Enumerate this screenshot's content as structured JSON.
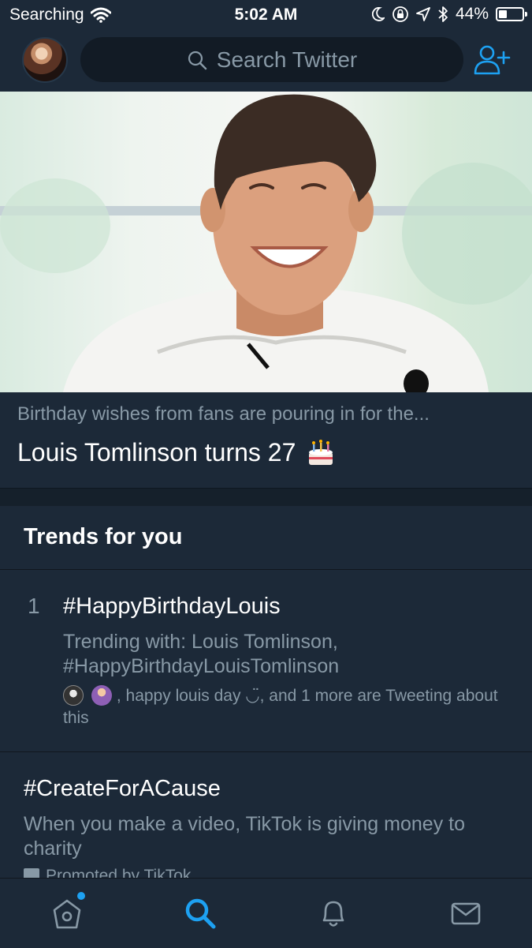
{
  "status_bar": {
    "carrier": "Searching",
    "time": "5:02 AM",
    "battery_percent": "44%",
    "battery_level": 0.44,
    "icons": [
      "wifi-icon",
      "moon-icon",
      "orientation-lock-icon",
      "location-arrow-icon",
      "bluetooth-icon",
      "battery-icon"
    ]
  },
  "nav": {
    "search_placeholder": "Search Twitter",
    "icons": [
      "profile-avatar",
      "search-icon",
      "add-user-icon"
    ]
  },
  "hero": {
    "subtitle": "Birthday wishes from fans are pouring in for the...",
    "title": "Louis Tomlinson turns 27",
    "title_emoji": "birthday-cake-icon"
  },
  "trends": {
    "heading": "Trends for you",
    "items": [
      {
        "rank": "1",
        "name": "#HappyBirthdayLouis",
        "context": "Trending with: Louis Tomlinson, #HappyBirthdayLouisTomlinson",
        "tweeting": ", happy louis day ◡̈, and 1 more are Tweeting about this"
      }
    ],
    "promoted": {
      "name": "#CreateForACause",
      "description": "When you make a video, TikTok is giving money to charity",
      "promoted_by": "Promoted by TikTok"
    }
  },
  "tab_bar": {
    "tabs": [
      "home",
      "search",
      "notifications",
      "messages"
    ],
    "active": "search",
    "accent_color": "#1da1f2",
    "inactive_color": "#8899a6"
  },
  "colors": {
    "background": "#15202b",
    "surface": "#1c2938",
    "secondary_text": "#8899a6",
    "accent": "#1da1f2"
  }
}
